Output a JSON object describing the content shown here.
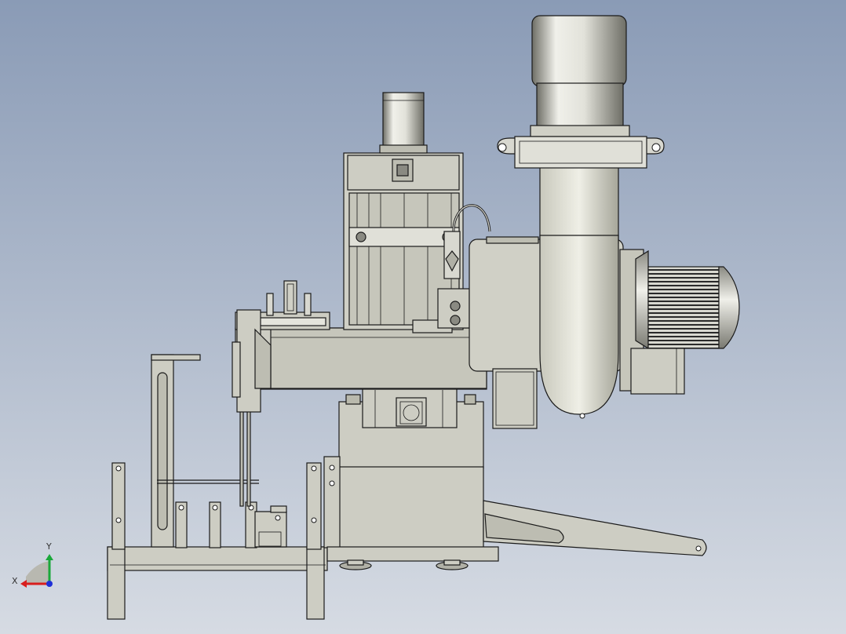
{
  "colors": {
    "background_top": "#8a9bb6",
    "background_bottom": "#d6dbe3",
    "body_fill": "#cdcdc3",
    "body_shade": "#b9b9ad",
    "motor_light": "#f0f0ea",
    "motor_dark": "#6e6e66",
    "axis_x": "#d81e1e",
    "axis_y": "#1aa83a",
    "axis_z": "#1e2fd8"
  },
  "icons": {
    "triad": "coordinate-triad-icon"
  },
  "triad": {
    "x_label": "X",
    "y_label": "Y"
  }
}
